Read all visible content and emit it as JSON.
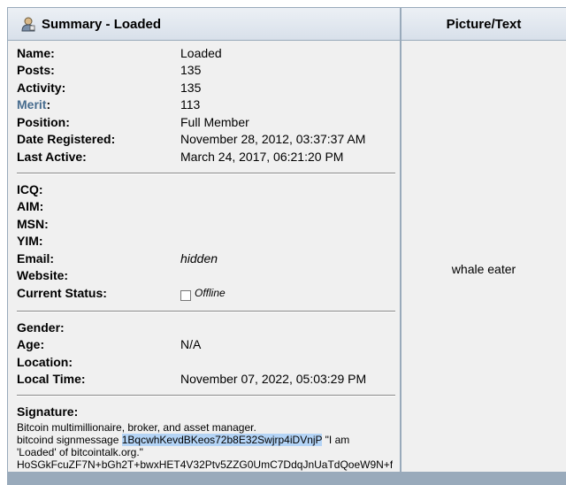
{
  "header": {
    "title": "Summary - Loaded",
    "icon": "user-profile-icon",
    "right_title": "Picture/Text"
  },
  "picture_text": "whale eater",
  "summary": {
    "name_label": "Name:",
    "name": "Loaded",
    "posts_label": "Posts:",
    "posts": "135",
    "activity_label": "Activity:",
    "activity": "135",
    "merit_label": "Merit",
    "merit": "113",
    "position_label": "Position:",
    "position": "Full Member",
    "registered_label": "Date Registered:",
    "registered": "November 28, 2012, 03:37:37 AM",
    "last_active_label": "Last Active:",
    "last_active": "March 24, 2017, 06:21:20 PM"
  },
  "contact": {
    "icq_label": "ICQ:",
    "aim_label": "AIM:",
    "msn_label": "MSN:",
    "yim_label": "YIM:",
    "email_label": "Email:",
    "email": "hidden",
    "website_label": "Website:",
    "status_label": "Current Status:",
    "status": "Offline"
  },
  "personal": {
    "gender_label": "Gender:",
    "age_label": "Age:",
    "age": "N/A",
    "location_label": "Location:",
    "local_time_label": "Local Time:",
    "local_time": "November 07, 2022, 05:03:29 PM"
  },
  "signature": {
    "label": "Signature:",
    "line1": "Bitcoin multimillionaire, broker, and asset manager.",
    "line2_prefix": "bitcoind signmessage ",
    "address": "1BqcwhKevdBKeos72b8E32Swjrp4iDVnjP",
    "line2_suffix": " \"I am",
    "line3": "'Loaded' of bitcointalk.org.\"",
    "line4": "HoSGkFcuZF7N+bGh2T+bwxHET4V32Ptv5ZZG0UmC7DdqJnUaTdQoeW9N+f"
  }
}
